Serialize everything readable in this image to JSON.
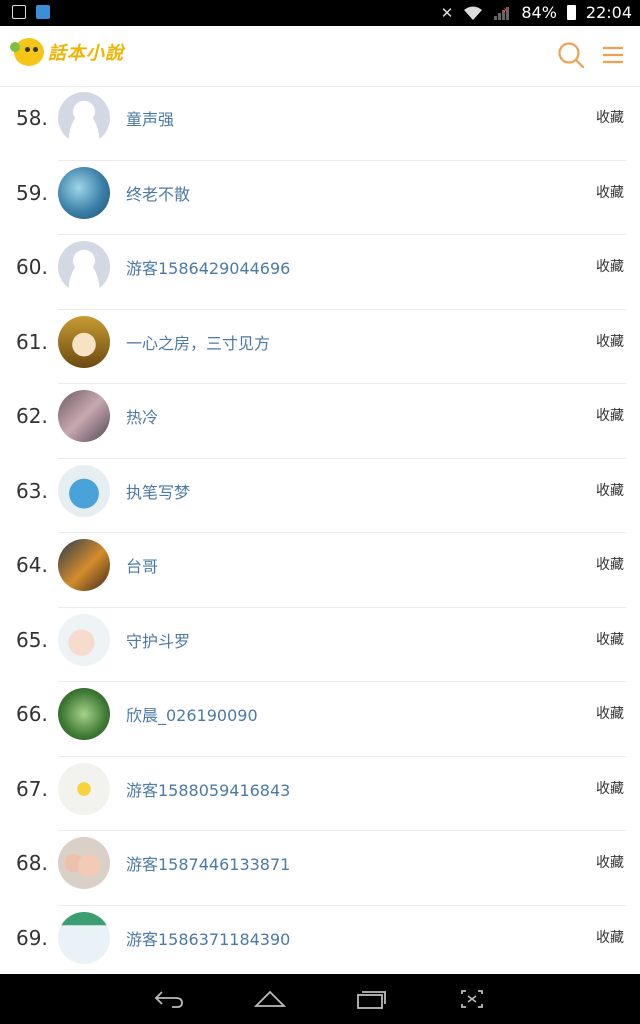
{
  "status_bar": {
    "battery": "84%",
    "time": "22:04"
  },
  "header": {
    "logo_text": "話本小說",
    "colors": {
      "accent": "#f0a050",
      "logo_yellow": "#f0b400"
    }
  },
  "list": {
    "items": [
      {
        "rank": "58.",
        "name": "童声强",
        "action": "收藏",
        "avatar": "default-avatar"
      },
      {
        "rank": "59.",
        "name": "终老不散",
        "action": "收藏",
        "avatar": "starry-sky-avatar"
      },
      {
        "rank": "60.",
        "name": "游客1586429044696",
        "action": "收藏",
        "avatar": "default-avatar"
      },
      {
        "rank": "61.",
        "name": "一心之房，三寸见方",
        "action": "收藏",
        "avatar": "anime-girl-avatar"
      },
      {
        "rank": "62.",
        "name": "热冷",
        "action": "收藏",
        "avatar": "photo-avatar"
      },
      {
        "rank": "63.",
        "name": "执笔写梦",
        "action": "收藏",
        "avatar": "stitch-avatar"
      },
      {
        "rank": "64.",
        "name": "台哥",
        "action": "收藏",
        "avatar": "anime-boy-avatar"
      },
      {
        "rank": "65.",
        "name": "守护斗罗",
        "action": "收藏",
        "avatar": "baby-avatar"
      },
      {
        "rank": "66.",
        "name": "欣晨_026190090",
        "action": "收藏",
        "avatar": "plant-avatar"
      },
      {
        "rank": "67.",
        "name": "游客1588059416843",
        "action": "收藏",
        "avatar": "sun-cartoon-avatar"
      },
      {
        "rank": "68.",
        "name": "游客1587446133871",
        "action": "收藏",
        "avatar": "kids-photo-avatar"
      },
      {
        "rank": "69.",
        "name": "游客1586371184390",
        "action": "收藏",
        "avatar": "snow-cartoon-avatar"
      }
    ]
  },
  "nav_bar": {
    "buttons": [
      "back-icon",
      "home-icon",
      "recents-icon",
      "screenshot-icon"
    ]
  }
}
